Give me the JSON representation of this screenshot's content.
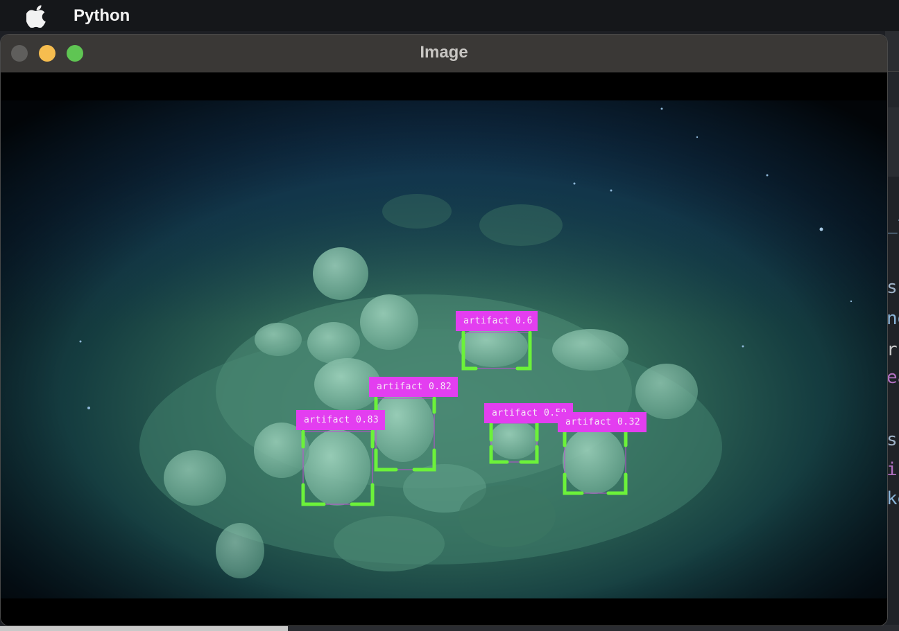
{
  "menubar": {
    "app_name": "Python",
    "icon": "apple-icon"
  },
  "window": {
    "title": "Image"
  },
  "detections": [
    {
      "id": "det-1",
      "label": "artifact 0.6"
    },
    {
      "id": "det-2",
      "label": "artifact 0.82"
    },
    {
      "id": "det-3",
      "label": "artifact 0.83"
    },
    {
      "id": "det-4",
      "label": "artifact 0.59"
    },
    {
      "id": "det-5",
      "label": "artifact 0.32"
    }
  ],
  "colors": {
    "label_bg": "#e33ef0",
    "box_corner": "#6cf23a",
    "box_edge": "#c24ad4"
  },
  "background_editor_fragments": [
    "_t",
    "s",
    "ng",
    "r",
    "ea",
    "s",
    "ir",
    "ke"
  ]
}
